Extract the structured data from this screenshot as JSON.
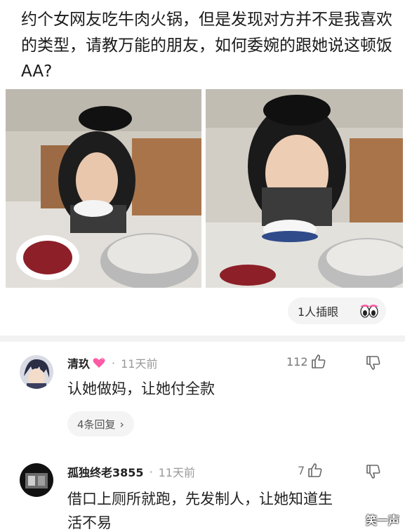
{
  "post": {
    "text": "约个女网友吃牛肉火锅，但是发现对方并不是我喜欢的类型，请教万能的朋友，如何委婉的跟她说这顿饭AA?"
  },
  "insert_eye": {
    "label": "1人插眼"
  },
  "comments": [
    {
      "name": "清玖",
      "time": "11天前",
      "likes": "112",
      "text": "认她做妈，让她付全款",
      "replies_label": "4条回复"
    },
    {
      "name": "孤独终老3855",
      "time": "11天前",
      "likes": "7",
      "text_line1": "借口上厕所就跑，先发制人，让她知道生",
      "text_line2": "活不易"
    }
  ],
  "watermark": "笑一声",
  "icons": {
    "photo_left": "restaurant-hotpot-photo",
    "photo_right": "restaurant-hotpot-photo",
    "eyes": "peeking-eyes-icon",
    "heart": "heart-icon",
    "thumb_up": "thumb-up-icon",
    "thumb_down": "thumb-down-icon",
    "chevron": "chevron-right-icon"
  },
  "colors": {
    "divider": "#f2f2f2",
    "pill_bg": "#f4f4f4",
    "heart": "#ff5aa5"
  }
}
